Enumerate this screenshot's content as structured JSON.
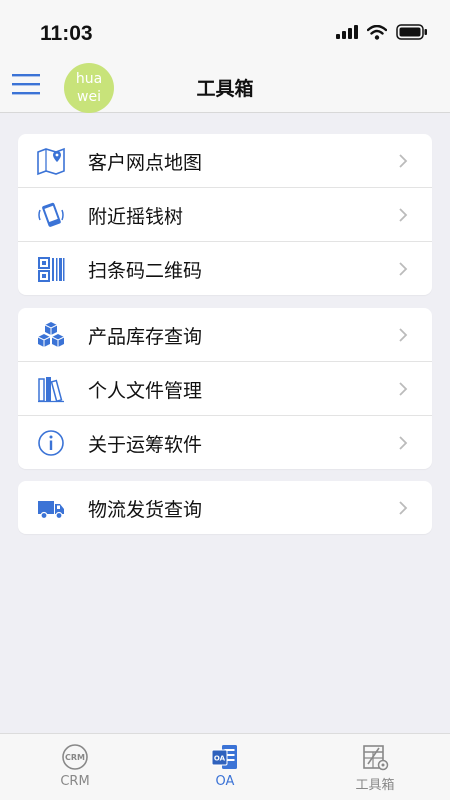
{
  "status_bar": {
    "time": "11:03"
  },
  "header": {
    "title": "工具箱",
    "avatar_line1": "hua",
    "avatar_line2": "wei"
  },
  "groups": [
    [
      {
        "label": "客户网点地图",
        "icon": "map-pin-icon"
      },
      {
        "label": "附近摇钱树",
        "icon": "shake-phone-icon"
      },
      {
        "label": "扫条码二维码",
        "icon": "barcode-icon"
      }
    ],
    [
      {
        "label": "产品库存查询",
        "icon": "boxes-icon"
      },
      {
        "label": "个人文件管理",
        "icon": "files-icon"
      },
      {
        "label": "关于运筹软件",
        "icon": "info-icon"
      }
    ],
    [
      {
        "label": "物流发货查询",
        "icon": "truck-icon"
      }
    ]
  ],
  "tabs": [
    {
      "label": "CRM",
      "icon_text": "CRM"
    },
    {
      "label": "OA",
      "icon_text": "OA"
    },
    {
      "label": "工具箱"
    }
  ],
  "colors": {
    "accent": "#3b73d6",
    "avatar": "#c8e37a"
  }
}
